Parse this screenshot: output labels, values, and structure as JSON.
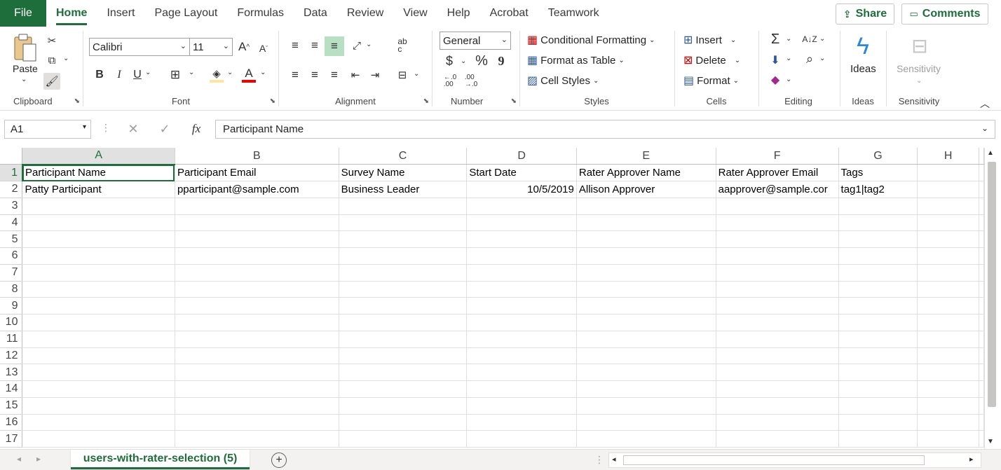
{
  "ribbon_tabs": {
    "file": "File",
    "home": "Home",
    "insert": "Insert",
    "page_layout": "Page Layout",
    "formulas": "Formulas",
    "data": "Data",
    "review": "Review",
    "view": "View",
    "help": "Help",
    "acrobat": "Acrobat",
    "teamwork": "Teamwork"
  },
  "top_buttons": {
    "share": "Share",
    "comments": "Comments"
  },
  "clipboard": {
    "paste": "Paste",
    "label": "Clipboard"
  },
  "font": {
    "name": "Calibri",
    "size": "11",
    "label": "Font",
    "bold": "B",
    "italic": "I",
    "underline": "U",
    "color_letter": "A"
  },
  "alignment": {
    "label": "Alignment"
  },
  "number": {
    "format": "General",
    "currency": "$",
    "percent": "%",
    "comma": "9",
    "label": "Number"
  },
  "styles": {
    "conditional": "Conditional Formatting",
    "format_table": "Format as Table",
    "cell_styles": "Cell Styles",
    "label": "Styles"
  },
  "cells": {
    "insert": "Insert",
    "delete": "Delete",
    "format": "Format",
    "label": "Cells"
  },
  "editing": {
    "label": "Editing"
  },
  "ideas": {
    "button": "Ideas",
    "label": "Ideas"
  },
  "sensitivity": {
    "button": "Sensitivity",
    "label": "Sensitivity"
  },
  "formula_bar": {
    "name_box": "A1",
    "fx": "fx",
    "content": "Participant Name"
  },
  "columns": [
    "A",
    "B",
    "C",
    "D",
    "E",
    "F",
    "G",
    "H"
  ],
  "rows": [
    "1",
    "2",
    "3",
    "4",
    "5",
    "6",
    "7",
    "8",
    "9",
    "10",
    "11",
    "12",
    "13",
    "14",
    "15",
    "16",
    "17"
  ],
  "cells_data": [
    [
      "Participant Name",
      "Participant Email",
      "Survey Name",
      "Start Date",
      "Rater Approver Name",
      "Rater Approver Email",
      "Tags",
      ""
    ],
    [
      "Patty Participant",
      "pparticipant@sample.com",
      "Business Leader",
      "10/5/2019",
      "Allison Approver",
      "aapprover@sample.cor",
      "tag1|tag2",
      ""
    ]
  ],
  "sheet_tab": "users-with-rater-selection (5)",
  "colors": {
    "accent": "#1e6e3c",
    "file_bg": "#1e6e3c"
  }
}
